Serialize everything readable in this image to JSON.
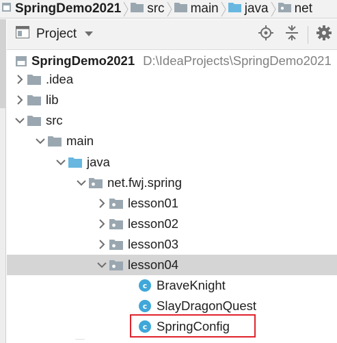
{
  "breadcrumb": {
    "items": [
      {
        "label": "SpringDemo2021",
        "icon": "module-icon"
      },
      {
        "label": "src",
        "icon": "folder-icon"
      },
      {
        "label": "main",
        "icon": "folder-icon"
      },
      {
        "label": "java",
        "icon": "source-folder-icon"
      },
      {
        "label": "net",
        "icon": "package-icon"
      }
    ]
  },
  "panel": {
    "view_label": "Project",
    "tools": [
      "locate-icon",
      "collapse-all-icon",
      "settings-icon"
    ]
  },
  "tree": {
    "root": {
      "label": "SpringDemo2021",
      "path": "D:\\IdeaProjects\\SpringDemo2021"
    },
    "idea": ".idea",
    "lib": "lib",
    "src": "src",
    "main": "main",
    "java": "java",
    "package": "net.fwj.spring",
    "lesson01": "lesson01",
    "lesson02": "lesson02",
    "lesson03": "lesson03",
    "lesson04": "lesson04",
    "class_letter": "c",
    "classes": [
      "BraveKnight",
      "SlayDragonQuest",
      "SpringConfig"
    ]
  },
  "colors": {
    "folder": "#9aa7b0",
    "source_folder": "#67b7e0",
    "class_icon": "#3fa7d9",
    "selection": "#d5d5d5",
    "highlight_border": "#e0222a"
  }
}
